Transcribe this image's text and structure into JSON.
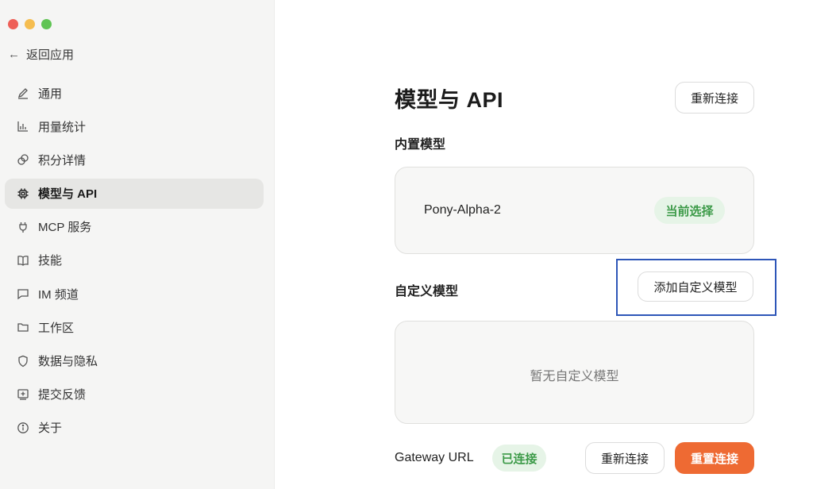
{
  "sidebar": {
    "back_label": "返回应用",
    "items": [
      {
        "label": "通用",
        "icon": "pencil-icon"
      },
      {
        "label": "用量统计",
        "icon": "bar-chart-icon"
      },
      {
        "label": "积分详情",
        "icon": "coins-icon"
      },
      {
        "label": "模型与 API",
        "icon": "chip-icon",
        "active": true
      },
      {
        "label": "MCP 服务",
        "icon": "plug-icon"
      },
      {
        "label": "技能",
        "icon": "book-icon"
      },
      {
        "label": "IM 频道",
        "icon": "chat-icon"
      },
      {
        "label": "工作区",
        "icon": "folder-icon"
      },
      {
        "label": "数据与隐私",
        "icon": "shield-icon"
      },
      {
        "label": "提交反馈",
        "icon": "feedback-icon"
      },
      {
        "label": "关于",
        "icon": "info-icon"
      }
    ]
  },
  "main": {
    "title": "模型与 API",
    "reconnect_top_label": "重新连接",
    "builtin_section_label": "内置模型",
    "builtin_model": {
      "name": "Pony-Alpha-2",
      "badge": "当前选择"
    },
    "custom_section_label": "自定义模型",
    "add_custom_label": "添加自定义模型",
    "custom_empty_text": "暂无自定义模型",
    "gateway": {
      "label": "Gateway URL",
      "status": "已连接",
      "reconnect_label": "重新连接",
      "reset_label": "重置连接"
    }
  },
  "colors": {
    "accent": "#ee6a33",
    "success_text": "#3c9a48",
    "success_bg": "#e6f4e7",
    "highlight_box": "#2e56b8"
  }
}
